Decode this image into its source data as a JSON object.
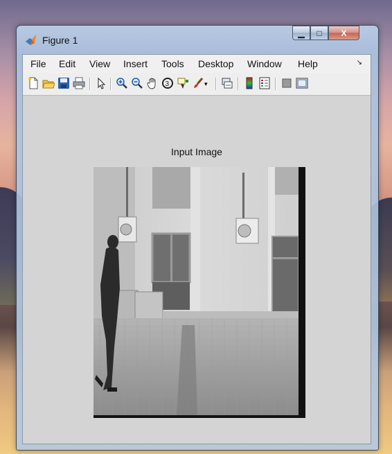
{
  "window": {
    "title": "Figure 1",
    "controls": {
      "minimize": "▁",
      "maximize": "□",
      "close": "X"
    }
  },
  "menu": {
    "items": [
      "File",
      "Edit",
      "View",
      "Insert",
      "Tools",
      "Desktop",
      "Window",
      "Help"
    ],
    "overflow_arrow": "↘"
  },
  "toolbar": {
    "icons": [
      "new-figure-icon",
      "open-file-icon",
      "save-icon",
      "print-icon",
      "select-arrow-icon",
      "zoom-in-icon",
      "zoom-out-icon",
      "pan-hand-icon",
      "rotate-3d-icon",
      "data-cursor-icon",
      "brush-icon",
      "brush-dropdown-icon",
      "link-plot-icon",
      "insert-colorbar-icon",
      "insert-legend-icon",
      "hide-plot-tools-icon",
      "show-plot-tools-icon"
    ]
  },
  "axes": {
    "title": "Input Image"
  },
  "colors": {
    "figure_bg": "#d4d4d4",
    "menubar_bg": "#f0f0f0",
    "close_button": "#c76453"
  }
}
